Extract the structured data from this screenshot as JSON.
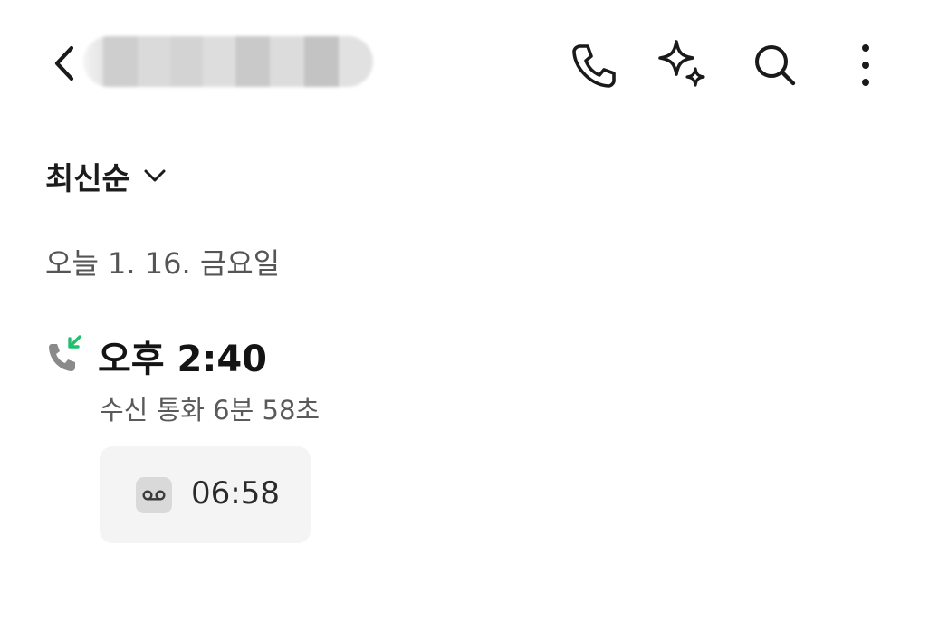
{
  "header": {
    "contact_name": "",
    "icons": {
      "back": "chevron-left-icon",
      "call": "phone-icon",
      "ai": "sparkle-icon",
      "search": "search-icon",
      "more": "more-vertical-icon"
    }
  },
  "sort": {
    "label": "최신순",
    "icon": "chevron-down-icon"
  },
  "date_group": {
    "label": "오늘 1. 16. 금요일"
  },
  "call_log": [
    {
      "type_icon": "incoming-call-icon",
      "time": "오후 2:40",
      "description": "수신 통화 6분 58초",
      "recording": {
        "icon": "voicemail-icon",
        "duration": "06:58"
      }
    }
  ],
  "colors": {
    "incoming_arrow": "#1fbf6e",
    "call_icon_gray": "#8a8a8a",
    "chip_bg": "#f4f4f4"
  }
}
